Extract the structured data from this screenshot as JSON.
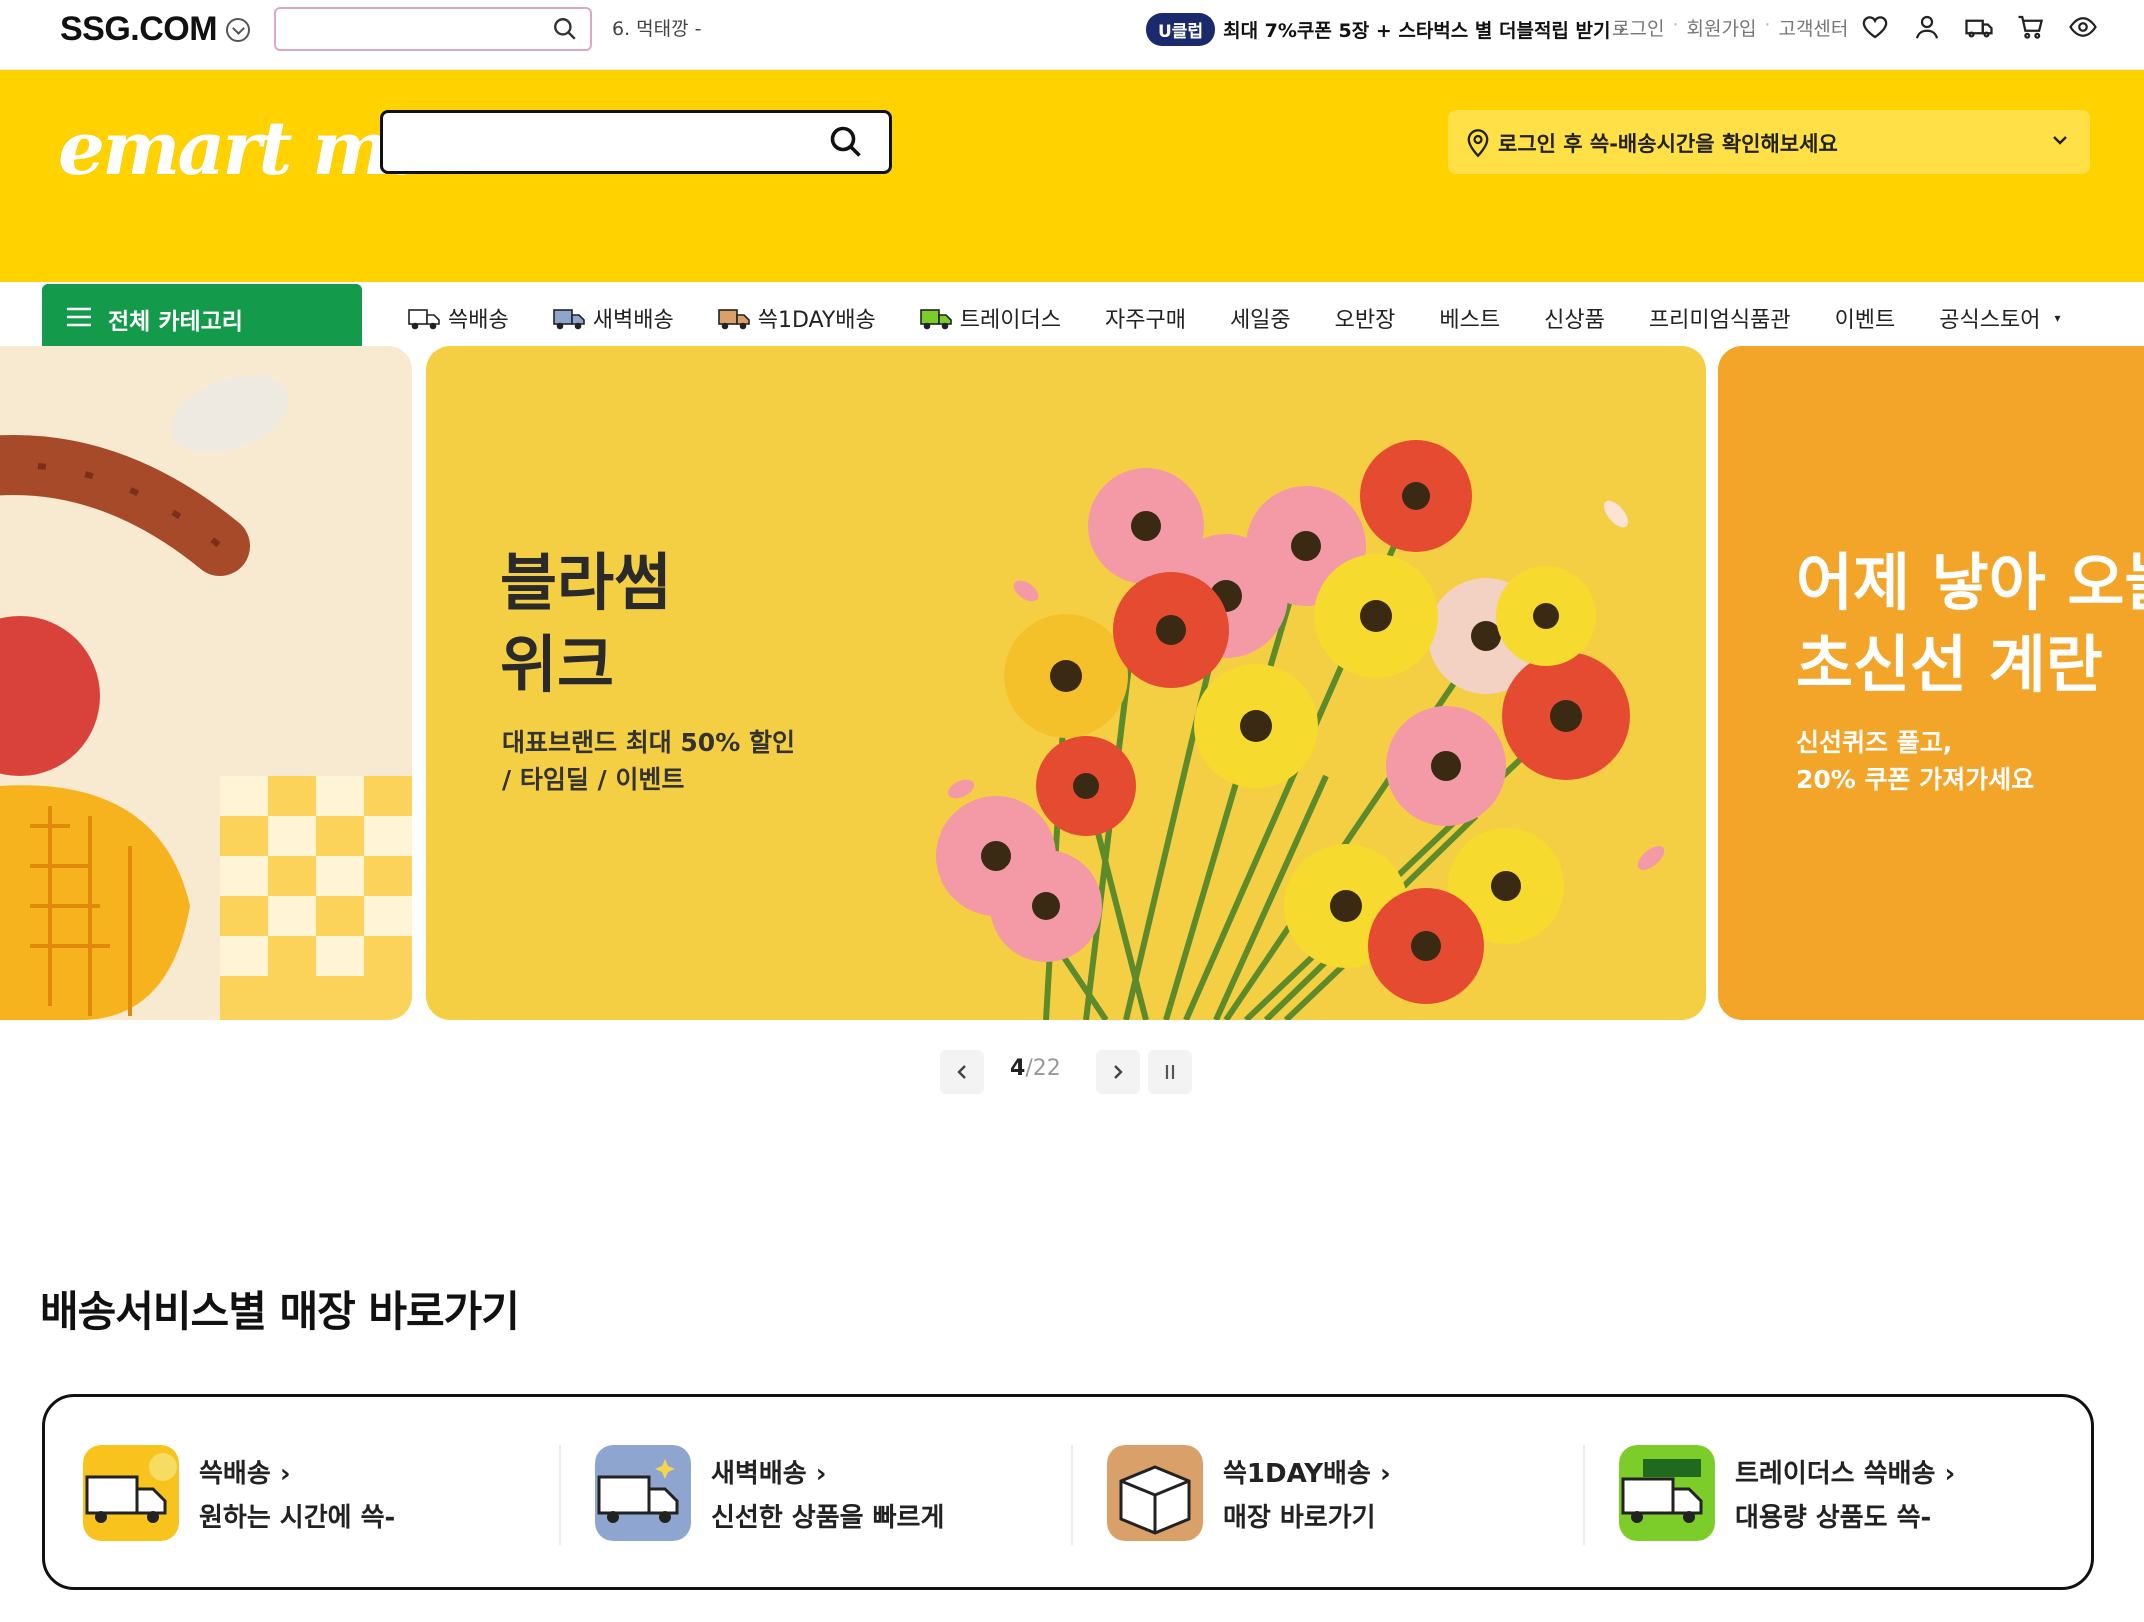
{
  "topbar": {
    "logo": "SSG.COM",
    "trending_keyword": "6. 먹태깡 -",
    "promo_badge": "U클럽",
    "promo_text": "최대 7%쿠폰 5장 + 스타벅스 별 더블적립 받기",
    "promo_arrow": "›",
    "links": [
      "로그인",
      "회원가입",
      "고객센터"
    ],
    "link_sep": "·",
    "icons": [
      "heart-icon",
      "user-icon",
      "delivery-truck-icon",
      "cart-icon",
      "eye-icon"
    ]
  },
  "header": {
    "logo": "emart mall",
    "delivery_notice": "로그인 후 쓱-배송시간을 확인해보세요",
    "brand_color": "#ffd200",
    "category_color": "#139a4a"
  },
  "nav": {
    "all_categories": "전체 카테고리",
    "items": [
      {
        "label": "쓱배송",
        "icon": "truck-icon"
      },
      {
        "label": "새벽배송",
        "icon": "truck-icon"
      },
      {
        "label": "쓱1DAY배송",
        "icon": "truck-icon"
      },
      {
        "label": "트레이더스",
        "icon": "truck-icon"
      },
      {
        "label": "자주구매"
      },
      {
        "label": "세일중"
      },
      {
        "label": "오반장"
      },
      {
        "label": "베스트"
      },
      {
        "label": "신상품"
      },
      {
        "label": "프리미엄식품관"
      },
      {
        "label": "이벤트"
      },
      {
        "label": "공식스토어",
        "caret": "▾"
      }
    ]
  },
  "banner": {
    "main": {
      "title": "블라썸\n위크",
      "subtitle": "대표브랜드 최대 50% 할인\n/ 타임딜 / 이벤트"
    },
    "right": {
      "title": "어제 낳아 오늘\n초신선 계란",
      "subtitle": "신선퀴즈 풀고,\n20% 쿠폰 가져가세요"
    },
    "counter_current": "4",
    "counter_sep": "/",
    "counter_total": "22"
  },
  "delivery_section": {
    "title": "배송서비스별 매장 바로가기",
    "services": [
      {
        "title": "쓱배송",
        "desc": "원하는 시간에 쓱-",
        "color": "#f9c31d"
      },
      {
        "title": "새벽배송",
        "desc": "신선한 상품을 빠르게",
        "color": "#8ea6cf"
      },
      {
        "title": "쓱1DAY배송",
        "desc": "매장 바로가기",
        "color": "#d9a06a"
      },
      {
        "title": "트레이더스 쓱배송",
        "desc": "대용량 상품도 쓱-",
        "color": "#7ccd2a"
      }
    ],
    "arrow": "›"
  }
}
